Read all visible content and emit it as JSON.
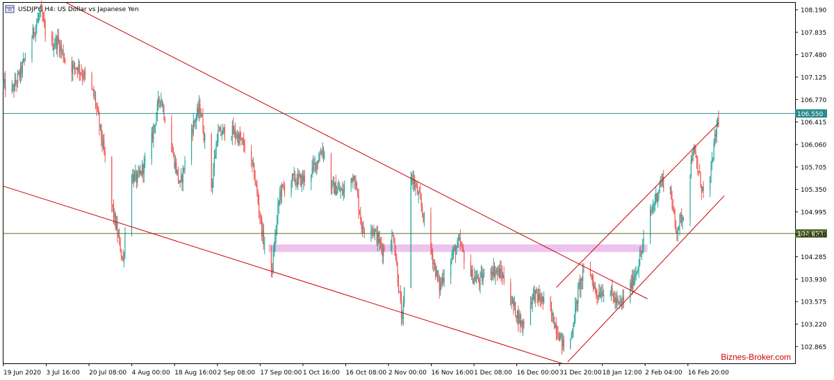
{
  "header": {
    "title": "USDJPY, H4:  US Dollar vs Japanese Yen",
    "icon": "chart-window-icon"
  },
  "watermark": "Biznes-Broker.com",
  "chart_data": {
    "type": "candlestick",
    "title": "USDJPY, H4:  US Dollar vs Japanese Yen",
    "ylim": [
      102.6,
      108.3
    ],
    "y_ticks": [
      "108.190",
      "107.835",
      "107.480",
      "107.125",
      "106.770",
      "106.415",
      "106.060",
      "105.705",
      "105.350",
      "104.995",
      "104.640",
      "104.285",
      "103.930",
      "103.575",
      "103.220",
      "102.865"
    ],
    "x_ticks": [
      "19 Jun 2020",
      "3 Jul 16:00",
      "20 Jul 08:00",
      "4 Aug 00:00",
      "18 Aug 16:00",
      "2 Sep 08:00",
      "17 Sep 00:00",
      "1 Oct 16:00",
      "16 Oct 08:00",
      "2 Nov 00:00",
      "16 Nov 16:00",
      "1 Dec 08:00",
      "16 Dec 00:00",
      "31 Dec 20:00",
      "18 Jan 12:00",
      "2 Feb 04:00",
      "16 Feb 20:00"
    ],
    "x_range": [
      "2020-06-19",
      "2021-02-25"
    ],
    "grid": false,
    "colors": {
      "up": "#26a69a",
      "down": "#ef5350",
      "trendline": "#cc0000",
      "current_line": "#2b8a8a",
      "level_line": "#556b2f",
      "zone": "#e8b4e8"
    },
    "price_path": [
      {
        "date": "2020-06-19",
        "price": 107.0
      },
      {
        "date": "2020-06-22",
        "price": 106.9
      },
      {
        "date": "2020-06-25",
        "price": 107.2
      },
      {
        "date": "2020-06-30",
        "price": 107.9
      },
      {
        "date": "2020-07-02",
        "price": 108.15
      },
      {
        "date": "2020-07-05",
        "price": 107.6
      },
      {
        "date": "2020-07-08",
        "price": 107.7
      },
      {
        "date": "2020-07-12",
        "price": 107.25
      },
      {
        "date": "2020-07-15",
        "price": 107.3
      },
      {
        "date": "2020-07-18",
        "price": 107.1
      },
      {
        "date": "2020-07-21",
        "price": 106.8
      },
      {
        "date": "2020-07-24",
        "price": 106.0
      },
      {
        "date": "2020-07-27",
        "price": 105.1
      },
      {
        "date": "2020-07-31",
        "price": 104.2
      },
      {
        "date": "2020-08-02",
        "price": 105.6
      },
      {
        "date": "2020-08-05",
        "price": 105.5
      },
      {
        "date": "2020-08-09",
        "price": 105.9
      },
      {
        "date": "2020-08-13",
        "price": 106.85
      },
      {
        "date": "2020-08-17",
        "price": 106.0
      },
      {
        "date": "2020-08-20",
        "price": 105.4
      },
      {
        "date": "2020-08-24",
        "price": 106.3
      },
      {
        "date": "2020-08-27",
        "price": 106.65
      },
      {
        "date": "2020-08-31",
        "price": 105.4
      },
      {
        "date": "2020-09-02",
        "price": 106.2
      },
      {
        "date": "2020-09-06",
        "price": 106.3
      },
      {
        "date": "2020-09-09",
        "price": 106.2
      },
      {
        "date": "2020-09-12",
        "price": 106.0
      },
      {
        "date": "2020-09-15",
        "price": 105.6
      },
      {
        "date": "2020-09-18",
        "price": 104.6
      },
      {
        "date": "2020-09-21",
        "price": 104.0
      },
      {
        "date": "2020-09-24",
        "price": 105.3
      },
      {
        "date": "2020-09-28",
        "price": 105.5
      },
      {
        "date": "2020-10-02",
        "price": 105.5
      },
      {
        "date": "2020-10-06",
        "price": 105.7
      },
      {
        "date": "2020-10-09",
        "price": 106.0
      },
      {
        "date": "2020-10-12",
        "price": 105.4
      },
      {
        "date": "2020-10-16",
        "price": 105.3
      },
      {
        "date": "2020-10-20",
        "price": 105.6
      },
      {
        "date": "2020-10-23",
        "price": 104.7
      },
      {
        "date": "2020-10-26",
        "price": 104.8
      },
      {
        "date": "2020-10-30",
        "price": 104.4
      },
      {
        "date": "2020-11-03",
        "price": 104.6
      },
      {
        "date": "2020-11-06",
        "price": 103.2
      },
      {
        "date": "2020-11-09",
        "price": 105.6
      },
      {
        "date": "2020-11-12",
        "price": 105.2
      },
      {
        "date": "2020-11-15",
        "price": 104.6
      },
      {
        "date": "2020-11-19",
        "price": 103.8
      },
      {
        "date": "2020-11-22",
        "price": 104.2
      },
      {
        "date": "2020-11-26",
        "price": 104.5
      },
      {
        "date": "2020-11-30",
        "price": 104.0
      },
      {
        "date": "2020-12-03",
        "price": 103.9
      },
      {
        "date": "2020-12-07",
        "price": 104.1
      },
      {
        "date": "2020-12-11",
        "price": 104.0
      },
      {
        "date": "2020-12-15",
        "price": 103.5
      },
      {
        "date": "2020-12-18",
        "price": 103.2
      },
      {
        "date": "2020-12-22",
        "price": 103.7
      },
      {
        "date": "2020-12-25",
        "price": 103.6
      },
      {
        "date": "2020-12-29",
        "price": 103.3
      },
      {
        "date": "2021-01-03",
        "price": 102.7
      },
      {
        "date": "2021-01-07",
        "price": 103.8
      },
      {
        "date": "2021-01-10",
        "price": 104.2
      },
      {
        "date": "2021-01-13",
        "price": 103.7
      },
      {
        "date": "2021-01-17",
        "price": 103.8
      },
      {
        "date": "2021-01-21",
        "price": 103.5
      },
      {
        "date": "2021-01-25",
        "price": 103.8
      },
      {
        "date": "2021-01-28",
        "price": 104.2
      },
      {
        "date": "2021-02-01",
        "price": 104.95
      },
      {
        "date": "2021-02-05",
        "price": 105.5
      },
      {
        "date": "2021-02-08",
        "price": 105.35
      },
      {
        "date": "2021-02-10",
        "price": 104.7
      },
      {
        "date": "2021-02-13",
        "price": 105.0
      },
      {
        "date": "2021-02-16",
        "price": 106.0
      },
      {
        "date": "2021-02-19",
        "price": 105.4
      },
      {
        "date": "2021-02-21",
        "price": 105.1
      },
      {
        "date": "2021-02-23",
        "price": 105.9
      },
      {
        "date": "2021-02-25",
        "price": 106.55
      }
    ],
    "trendlines": [
      {
        "name": "resistance",
        "from": {
          "date": "2020-07-08",
          "price": 108.37
        },
        "to": {
          "date": "2021-01-31",
          "price": 103.62
        }
      },
      {
        "name": "support",
        "from": {
          "date": "2020-06-19",
          "price": 105.4
        },
        "to": {
          "date": "2021-01-03",
          "price": 102.57
        }
      },
      {
        "name": "channel-lower",
        "from": {
          "date": "2021-01-03",
          "price": 102.62
        },
        "to": {
          "date": "2021-02-27",
          "price": 105.25
        }
      },
      {
        "name": "channel-upper",
        "from": {
          "date": "2020-12-30",
          "price": 103.8
        },
        "to": {
          "date": "2021-02-25",
          "price": 106.4
        }
      }
    ],
    "horizontal_lines": [
      {
        "name": "current",
        "price": 106.55,
        "label": "106.550"
      },
      {
        "name": "level",
        "price": 104.653,
        "label": "104.653"
      }
    ],
    "zone": {
      "from": "2020-09-20",
      "to": "2021-01-31",
      "low": 104.36,
      "high": 104.48
    }
  }
}
